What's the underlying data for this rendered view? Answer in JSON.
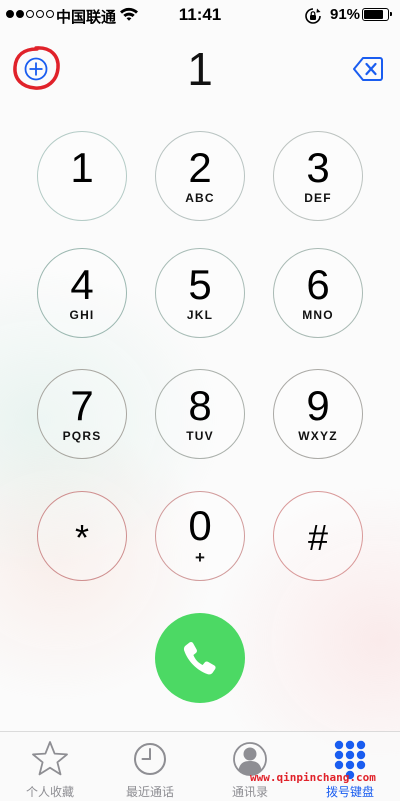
{
  "status_bar": {
    "carrier": "中国联通",
    "time": "11:41",
    "battery_percent": "91%",
    "battery_level": 0.91,
    "signal_bars_filled": 2,
    "signal_bars_total": 5,
    "icons": [
      "wifi-icon",
      "rotation-lock-icon",
      "battery-icon"
    ]
  },
  "dialer": {
    "number": "1",
    "add_icon": "plus-circle-icon",
    "delete_icon": "delete-backspace-icon",
    "accent_color": "#1a5df0",
    "highlight_color": "#e0222a"
  },
  "keypad": [
    {
      "digit": "1",
      "letters": ""
    },
    {
      "digit": "2",
      "letters": "ABC"
    },
    {
      "digit": "3",
      "letters": "DEF"
    },
    {
      "digit": "4",
      "letters": "GHI"
    },
    {
      "digit": "5",
      "letters": "JKL"
    },
    {
      "digit": "6",
      "letters": "MNO"
    },
    {
      "digit": "7",
      "letters": "PQRS"
    },
    {
      "digit": "8",
      "letters": "TUV"
    },
    {
      "digit": "9",
      "letters": "WXYZ"
    },
    {
      "digit": "*",
      "letters": ""
    },
    {
      "digit": "0",
      "letters": "+"
    },
    {
      "digit": "#",
      "letters": ""
    }
  ],
  "call_button": {
    "icon": "phone-icon",
    "color": "#4cd964"
  },
  "tab_bar": {
    "tabs": [
      {
        "label": "个人收藏",
        "icon": "star-icon",
        "active": false
      },
      {
        "label": "最近通话",
        "icon": "clock-icon",
        "active": false
      },
      {
        "label": "通讯录",
        "icon": "contacts-icon",
        "active": false
      },
      {
        "label": "拨号键盘",
        "icon": "keypad-icon",
        "active": true
      }
    ],
    "active_color": "#1a5df0",
    "inactive_color": "#8e8e93"
  },
  "watermark": "www.qinpinchang.com"
}
